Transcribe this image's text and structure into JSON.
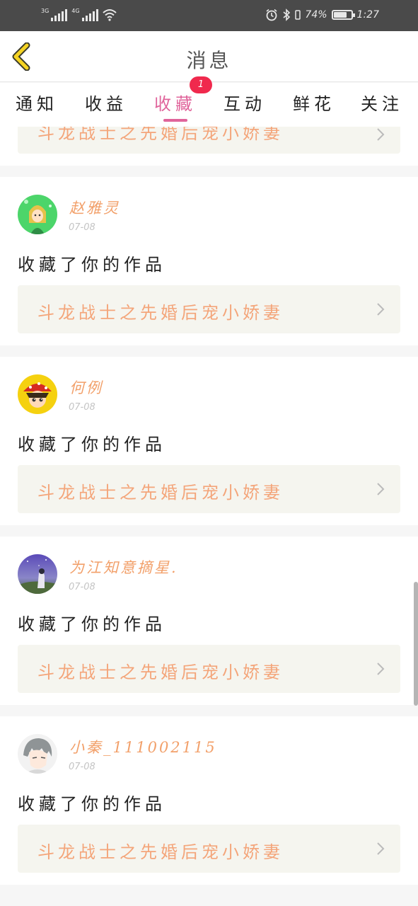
{
  "status_bar": {
    "net1": "3G",
    "net2": "4G",
    "battery": "74%",
    "battery_level": 0.74,
    "time": "1:27"
  },
  "header": {
    "title": "消息"
  },
  "tabs": {
    "items": [
      "通知",
      "收益",
      "收藏",
      "互动",
      "鲜花",
      "关注"
    ],
    "active_index": 2,
    "badge": "1"
  },
  "feed": {
    "top_partial": {
      "work_title": "斗龙战士之先婚后宠小娇妻"
    },
    "items": [
      {
        "user": "赵雅灵",
        "time": "07-08",
        "action": "收藏了你的作品",
        "work_title": "斗龙战士之先婚后宠小娇妻",
        "avatar": "green-cartoon-girl-avatar"
      },
      {
        "user": "何例",
        "time": "07-08",
        "action": "收藏了你的作品",
        "work_title": "斗龙战士之先婚后宠小娇妻",
        "avatar": "red-cap-cartoon-avatar"
      },
      {
        "user": "为江知意摘星.",
        "time": "07-08",
        "action": "收藏了你的作品",
        "work_title": "斗龙战士之先婚后宠小娇妻",
        "avatar": "night-sky-photo-avatar"
      },
      {
        "user": "小秦_111002115",
        "time": "07-08",
        "action": "收藏了你的作品",
        "work_title": "斗龙战士之先婚后宠小娇妻",
        "avatar": "gray-hair-anime-avatar"
      }
    ]
  },
  "colors": {
    "accent": "#e0649b",
    "badge": "#f0294d",
    "name": "#f2a06a",
    "work": "#f4a57a",
    "back": "#f5d323"
  }
}
